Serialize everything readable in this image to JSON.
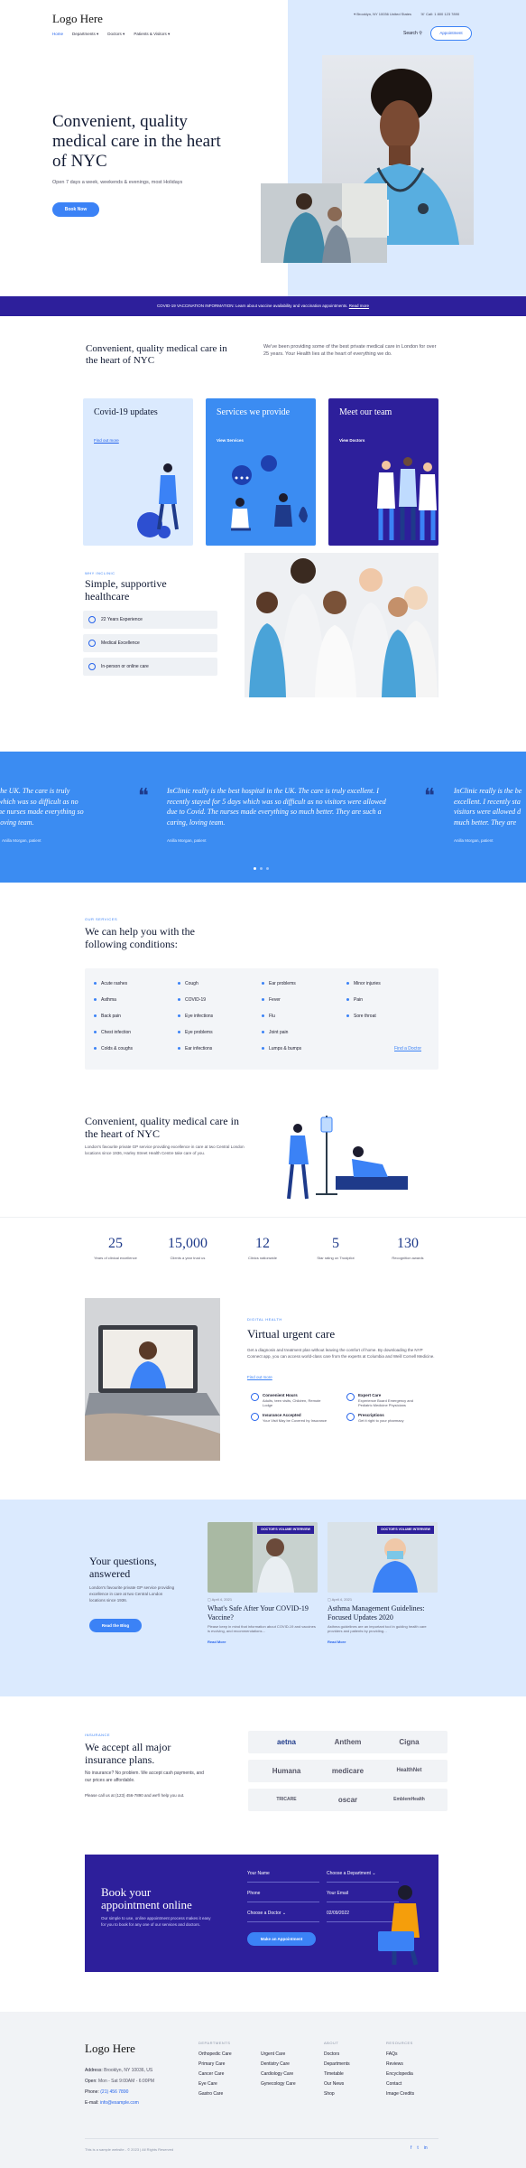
{
  "header": {
    "logo": "Logo Here",
    "nav": [
      "Home",
      "Departments ▾",
      "Doctors ▾",
      "Patients & Visitors ▾"
    ],
    "address": "Brooklyn, NY 10036 United States",
    "phone": "Call: 1 800 123 7890",
    "search": "Search",
    "appointment_btn": "Appointment"
  },
  "hero": {
    "title": "Convenient, quality medical care in the heart of NYC",
    "subtitle": "Open 7 days a week, weekends & evenings, most Holidays",
    "cta": "Book Now"
  },
  "covid_banner": {
    "text": "COVID-19 VACCINATION INFORMATION: Learn about vaccine availability and vaccination appointments.",
    "link": "Read more"
  },
  "intro": {
    "title": "Convenient, quality medical care in the heart of NYC",
    "text": "We've been providing some of the best private medical care in London for over 25 years. Your Health lies at the heart of everything we do.",
    "cards": [
      {
        "title": "Covid-19 updates",
        "link": "Find out more"
      },
      {
        "title": "Services we provide",
        "link": "View Services"
      },
      {
        "title": "Meet our team",
        "link": "View Doctors"
      }
    ]
  },
  "why": {
    "eyebrow": "WHY INCLINIC",
    "title": "Simple, supportive healthcare",
    "features": [
      "22 Years Experience",
      "Medical Excellence",
      "In-person or online care"
    ]
  },
  "testimonials": {
    "quote": "InClinic really is the best hospital in the UK. The care is truly excellent. I recently stayed for 5 days which was so difficult as no visitors were allowed due to Covid. The nurses made everything so much better. They are such a caring, loving team.",
    "left_fragment": "the UK. The care is truly which was so difficult as no he nurses made everything so loving team.",
    "right_fragment": "InClinic really is the be excellent. I recently sta visitors were allowed d much better. They are",
    "author": "Anilla Morgan, patient"
  },
  "conditions": {
    "eyebrow": "OUR SERVICES",
    "title": "We can help you with the following conditions:",
    "columns": [
      [
        "Acute rashes",
        "Asthma",
        "Back pain",
        "Chest infection",
        "Colds & coughs"
      ],
      [
        "Cough",
        "COVID-19",
        "Eye infections",
        "Eye problems",
        "Ear infections"
      ],
      [
        "Ear problems",
        "Fever",
        "Flu",
        "Joint pain",
        "Lumps & bumps"
      ],
      [
        "Minor injuries",
        "Pain",
        "Sore throat"
      ]
    ],
    "link": "Find a Doctor"
  },
  "about": {
    "title": "Convenient, quality medical care in the heart of NYC",
    "text": "London's favourite private GP service providing excellence in care at two Central London locations since 1936, Harley Street Health Centre take care of you."
  },
  "stats": [
    {
      "n": "25",
      "d": "Years of clinical excellence"
    },
    {
      "n": "15,000",
      "d": "Clients a year trust us"
    },
    {
      "n": "12",
      "d": "Clinics nationwide"
    },
    {
      "n": "5",
      "d": "Star rating on Trustpilot"
    },
    {
      "n": "130",
      "d": "Recognition awards"
    }
  ],
  "virtual": {
    "eyebrow": "DIGITAL HEALTH",
    "title": "Virtual urgent care",
    "text": "Get a diagnosis and treatment plan without leaving the comfort of home. By downloading the NYP Connect app, you can access world-class care from the experts at Columbia and Weill Cornell Medicine.",
    "link": "Find out more",
    "services": [
      {
        "t": "Convenient Hours",
        "d": "Adults, teen visits, Children, Remote Lodge"
      },
      {
        "t": "Expert Care",
        "d": "Experience Board Emergency and Pediatric Medicine Physicians"
      },
      {
        "t": "Insurance Accepted",
        "d": "Your Visit May be Covered by Insurance"
      },
      {
        "t": "Prescriptions",
        "d": "Get it right to your pharmacy"
      }
    ]
  },
  "blog": {
    "title": "Your questions, answered",
    "text": "London's favourite private GP service providing excellence in care at two Central London locations since 1936.",
    "cta": "Read the Blog",
    "posts": [
      {
        "tag": "DOCTOR'S VOLUME  INTERVIEW",
        "date": "April 4, 2021",
        "title": "What's Safe After Your COVID-19 Vaccine?",
        "excerpt": "Please keep in mind that information about COVID-19 and vaccines is evolving, and recommendations…",
        "link": "Read More"
      },
      {
        "tag": "DOCTOR'S VOLUME  INTERVIEW",
        "date": "April 4, 2021",
        "title": "Asthma Management Guidelines: Focused Updates 2020",
        "excerpt": "Asthma guidelines are an important tool in guiding health care providers and patients by providing…",
        "link": "Read More"
      }
    ]
  },
  "insurance": {
    "eyebrow": "INSURANCE",
    "title": "We accept all major insurance plans.",
    "text": "No insurance? No problem. We accept cash payments, and our prices are affordable.",
    "call": "Please call us at (123) 456-7890 and we'll help you out.",
    "logos": [
      "aetna",
      "Anthem",
      "Cigna",
      "Humana",
      "medicare",
      "HealthNet",
      "TRICARE",
      "oscar",
      "EmblemHealth"
    ]
  },
  "booking": {
    "title": "Book your appointment online",
    "text": "Our simple to use, online appointment process makes it easy for you to book for any one of our services and doctors.",
    "fields": [
      "Your Name",
      "Choose a Department",
      "Phone",
      "Your Email",
      "Choose a Doctor",
      "02/09/2022"
    ],
    "cta": "Make an Appointment"
  },
  "footer": {
    "logo": "Logo Here",
    "contact": [
      {
        "k": "Address:",
        "v": "Brooklyn, NY 10036, US"
      },
      {
        "k": "Open:",
        "v": "Mon - Sat 9:00AM - 6:00PM"
      },
      {
        "k": "Phone:",
        "v": "(21) 456 7890"
      },
      {
        "k": "E-mail:",
        "v": "info@example.com"
      }
    ],
    "cols": [
      {
        "h": "DEPARTMENTS",
        "items": [
          "Orthopedic Care",
          "Primary Care",
          "Cancer Care",
          "Eye Care",
          "Gastro Care"
        ]
      },
      {
        "h": "",
        "items": [
          "Urgent Care",
          "Dentistry Care",
          "Cardiology Care",
          "Gynecology Care"
        ]
      },
      {
        "h": "ABOUT",
        "items": [
          "Doctors",
          "Departments",
          "Timetable",
          "Our News",
          "Shop"
        ]
      },
      {
        "h": "RESOURCES",
        "items": [
          "FAQs",
          "Reviews",
          "Encyclopedia",
          "Contact",
          "Image Credits"
        ]
      }
    ],
    "copyright": "This is a sample website - © 2023 | All Rights Reserved"
  }
}
